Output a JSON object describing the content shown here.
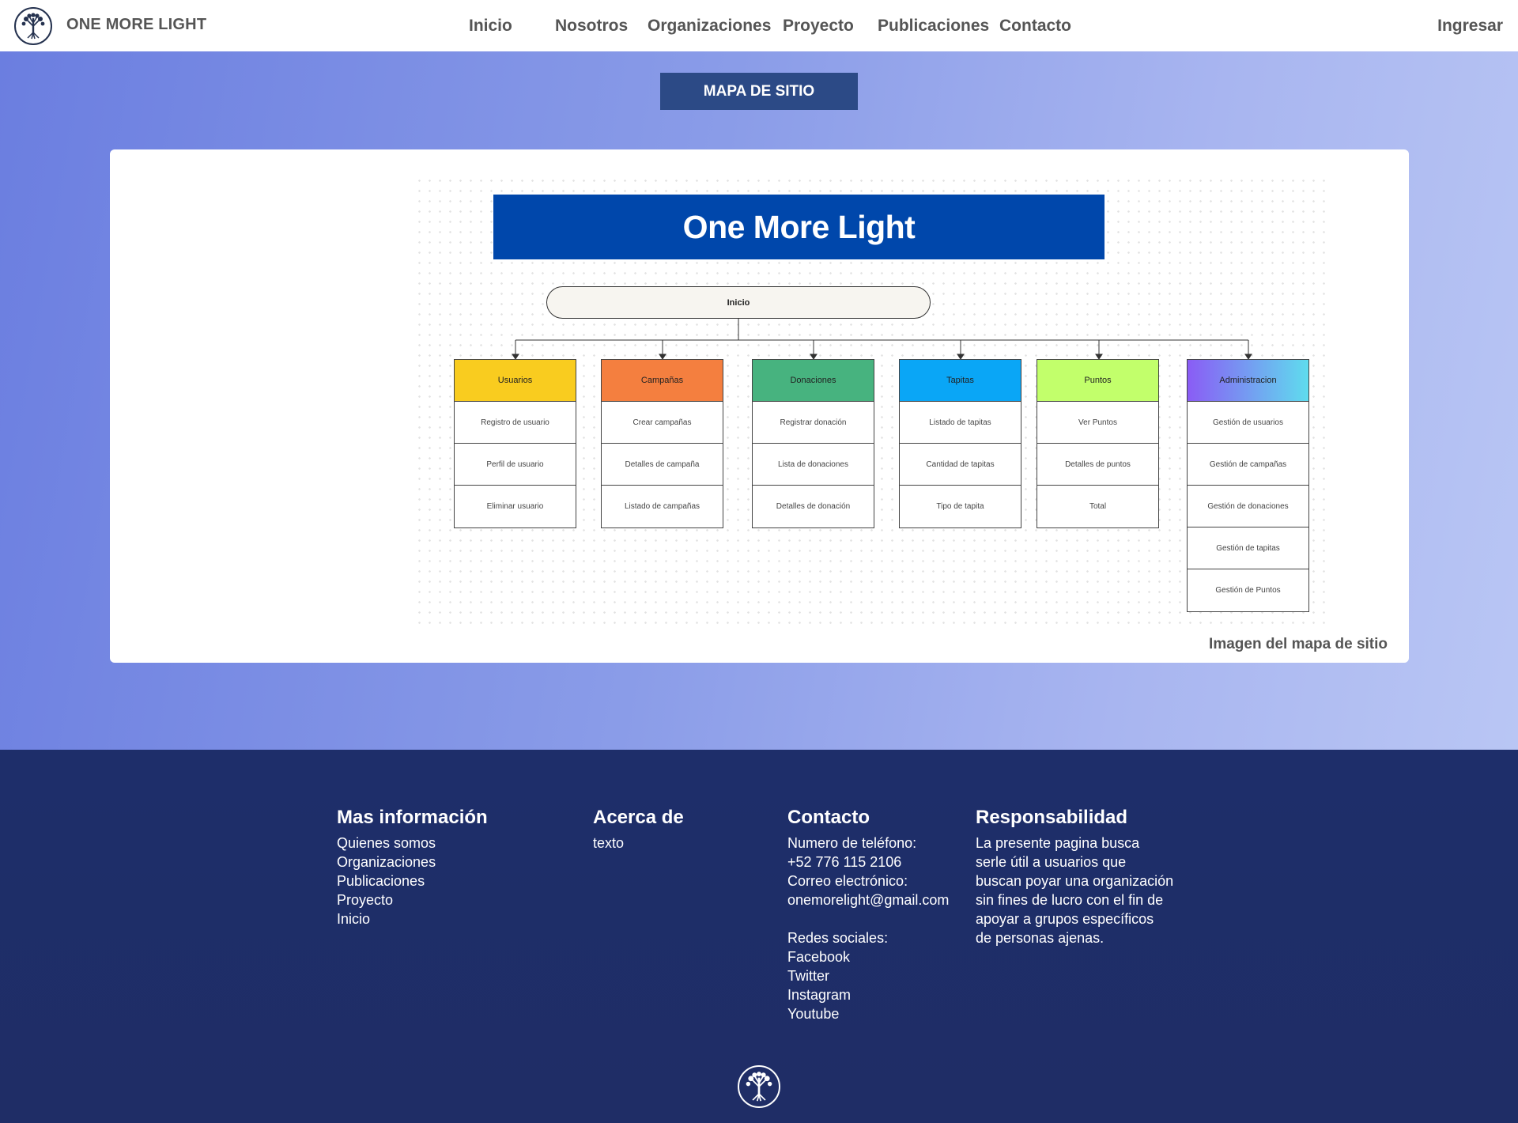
{
  "navbar": {
    "brand": "ONE MORE LIGHT",
    "links": [
      "Inicio",
      "Nosotros",
      "Organizaciones",
      "Proyecto",
      "Publicaciones",
      "Contacto"
    ],
    "login": "Ingresar",
    "logo_icon": "tree-of-life-icon"
  },
  "hero": {
    "button_label": "MAPA DE SITIO",
    "caption": "Imagen del mapa de sitio"
  },
  "sitemap": {
    "title": "One More Light",
    "root": "Inicio",
    "columns": [
      {
        "label": "Usuarios",
        "color": "#f9cc1f",
        "items": [
          "Registro de usuario",
          "Perfil de usuario",
          "Eliminar usuario"
        ]
      },
      {
        "label": "Campañas",
        "color": "#f47f3f",
        "items": [
          "Crear campañas",
          "Detalles de campaña",
          "Listado de campañas"
        ]
      },
      {
        "label": "Donaciones",
        "color": "#47b37f",
        "items": [
          "Registrar donación",
          "Lista de donaciones",
          "Detalles de donación"
        ]
      },
      {
        "label": "Tapitas",
        "color": "#0aa6f6",
        "items": [
          "Listado de tapitas",
          "Cantidad de tapitas",
          "Tipo de tapita"
        ]
      },
      {
        "label": "Puntos",
        "color": "#c2ff6b",
        "items": [
          "Ver Puntos",
          "Detalles de puntos",
          "Total"
        ]
      },
      {
        "label": "Administracion",
        "color": "#8a5cf5",
        "items": [
          "Gestión de usuarios",
          "Gestión de campañas",
          "Gestión de donaciones",
          "Gestión de tapitas",
          "Gestión de  Puntos"
        ]
      }
    ]
  },
  "footer": {
    "mas_info": {
      "title": "Mas información",
      "links": [
        "Quienes somos",
        "Organizaciones",
        "Publicaciones",
        "Proyecto",
        "Inicio"
      ]
    },
    "acerca": {
      "title": "Acerca de",
      "text": "texto"
    },
    "contacto": {
      "title": "Contacto",
      "lines": [
        "Numero de teléfono:",
        "+52 776 115 2106",
        "Correo electrónico:",
        "onemorelight@gmail.com",
        "",
        "Redes sociales:",
        "Facebook",
        "Twitter",
        "Instagram",
        "Youtube"
      ]
    },
    "responsabilidad": {
      "title": "Responsabilidad",
      "lines": [
        "La presente pagina busca",
        "serle útil a usuarios que",
        "buscan poyar una organización",
        "sin fines de lucro con el fin de",
        "apoyar a grupos específicos",
        "de personas ajenas."
      ]
    },
    "logo_icon": "tree-of-life-icon"
  }
}
